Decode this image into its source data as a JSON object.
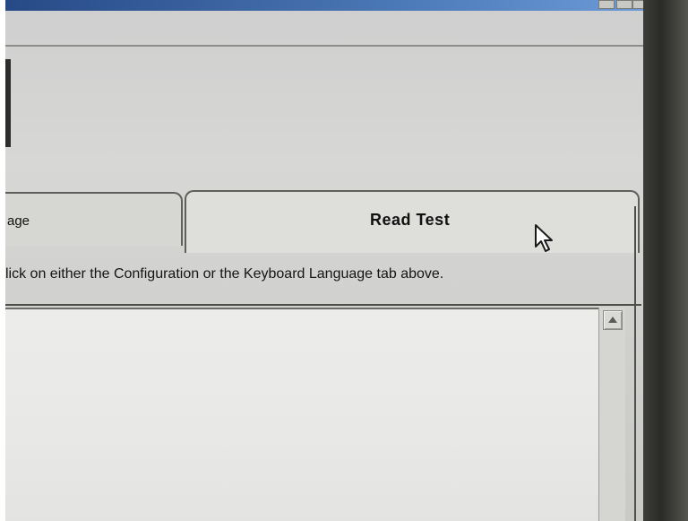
{
  "tabs": [
    {
      "label": "age",
      "active": false
    },
    {
      "label": "Read Test",
      "active": true
    }
  ],
  "instructions": "lick on either the Configuration or the Keyboard Language tab above.",
  "text_area": {
    "value": ""
  },
  "icons": {
    "scroll_up": "triangle-up-icon",
    "cursor": "arrow-cursor-icon"
  },
  "colors": {
    "window_face": "#d6d7d3",
    "text_area_bg": "#ececea",
    "title_bar": "#274a86"
  }
}
